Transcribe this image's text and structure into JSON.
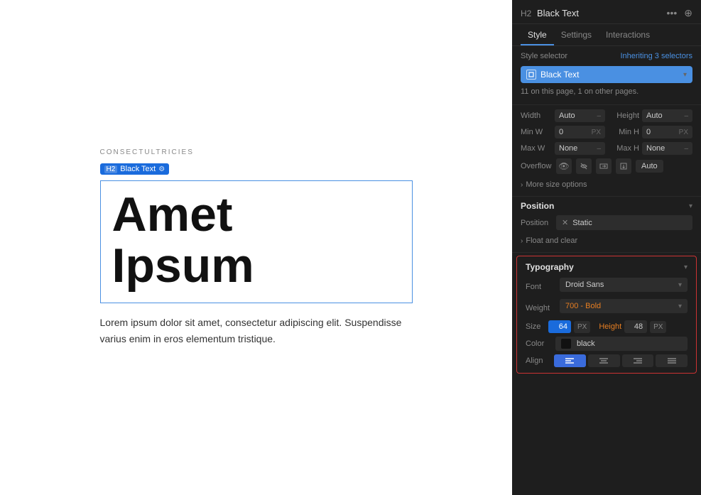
{
  "canvas": {
    "small_label": "CONSECTULTRICIES",
    "element_tag": "H2  Black Text",
    "h2_badge": "H2",
    "tag_name": "Black Text",
    "heading_text_line1": "Amet",
    "heading_text_line2": "Ipsum",
    "body_text": "Lorem ipsum dolor sit amet, consectetur adipiscing elit. Suspendisse varius enim in eros elementum tristique."
  },
  "panel": {
    "title": "Black Text",
    "h2_badge": "H2",
    "tabs": [
      "Style",
      "Settings",
      "Interactions"
    ],
    "active_tab": "Style",
    "style_selector_label": "Style selector",
    "inheriting_prefix": "Inheriting ",
    "inheriting_count": "3 selectors",
    "selector_name": "Black Text",
    "info_text": "11 on this page, 1 on other pages.",
    "width_label": "Width",
    "width_value": "Auto",
    "height_label": "Height",
    "height_value": "Auto",
    "min_w_label": "Min W",
    "min_w_value": "0",
    "min_w_unit": "PX",
    "min_h_label": "Min H",
    "min_h_value": "0",
    "min_h_unit": "PX",
    "max_w_label": "Max W",
    "max_w_value": "None",
    "max_h_label": "Max H",
    "max_h_value": "None",
    "overflow_label": "Overflow",
    "overflow_auto": "Auto",
    "more_size_options": "More size options",
    "position_section_title": "Position",
    "position_label": "Position",
    "position_value": "Static",
    "float_clear": "Float and clear",
    "typography_section_title": "Typography",
    "font_label": "Font",
    "font_value": "Droid Sans",
    "weight_label": "Weight",
    "weight_value": "700 - Bold",
    "size_label": "Size",
    "size_value": "64",
    "size_unit": "PX",
    "height_size_label": "Height",
    "height_size_value": "48",
    "height_size_unit": "PX",
    "color_label": "Color",
    "color_value": "black",
    "align_label": "Align"
  }
}
